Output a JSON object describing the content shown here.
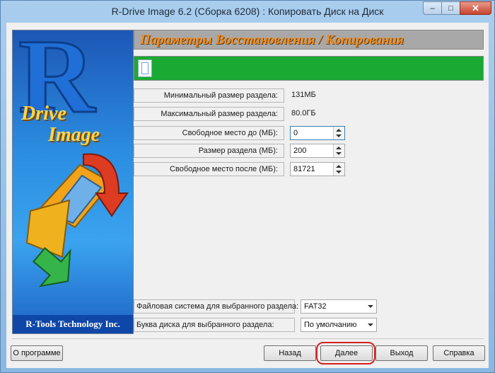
{
  "window": {
    "title": "R-Drive Image 6.2 (Сборка 6208) : Копировать Диск на Диск",
    "controls": {
      "minimize": "‒",
      "maximize": "□",
      "close": "✕"
    }
  },
  "banner": {
    "letter": "R",
    "word1": "Drive",
    "word2": "Image",
    "footer": "R-Tools Technology Inc."
  },
  "header": {
    "title": "Параметры Восстановления / Копирования"
  },
  "params": {
    "min_size": {
      "label": "Минимальный размер раздела:",
      "value": "131МБ"
    },
    "max_size": {
      "label": "Максимальный размер раздела:",
      "value": "80.0ГБ"
    },
    "free_before": {
      "label": "Свободное место до (МБ):",
      "value": "0"
    },
    "partition_size": {
      "label": "Размер раздела (МБ):",
      "value": "200"
    },
    "free_after": {
      "label": "Свободное место после (МБ):",
      "value": "81721"
    }
  },
  "filesystem": {
    "label": "Файловая система для выбранного раздела:",
    "value": "FAT32"
  },
  "drive_letter": {
    "label": "Буква диска для выбранного раздела:",
    "value": "По умолчанию"
  },
  "buttons": {
    "about": "О программе",
    "back": "Назад",
    "next": "Далее",
    "exit": "Выход",
    "help": "Справка"
  },
  "colors": {
    "progress": "#1aaa34",
    "header_text": "#f28a1a",
    "highlight": "#d82121"
  }
}
